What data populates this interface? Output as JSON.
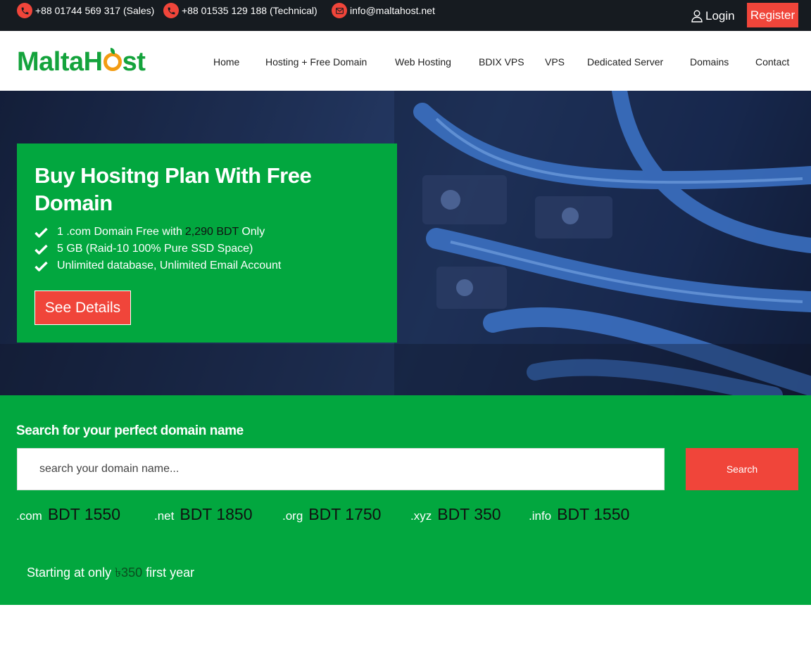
{
  "topbar": {
    "sales_phone": "+88 01744 569 317 (Sales)",
    "tech_phone": "+88 01535 129 188 (Technical)",
    "email": "info@maltahost.net",
    "login": "Login",
    "register": "Register"
  },
  "header": {
    "logo_part1": "Malta",
    "logo_part2": "H",
    "logo_part3": "st",
    "nav": [
      "Home",
      "Hosting + Free Domain",
      "Web Hosting",
      "BDIX VPS",
      "VPS",
      "Dedicated Server",
      "Domains",
      "Contact"
    ]
  },
  "hero": {
    "title": "Buy Hositng Plan With Free Domain",
    "features": [
      {
        "pre": "1 .com Domain Free with",
        "highlight": "2,290 BDT",
        "post": "Only"
      },
      {
        "text": "5 GB (Raid-10 100% Pure SSD Space)"
      },
      {
        "text": "Unlimited database, Unlimited Email Account"
      }
    ],
    "cta": "See Details"
  },
  "domain_search": {
    "title": "Search for your perfect domain name",
    "placeholder": "search your domain name...",
    "button": "Search",
    "tlds": [
      {
        "ext": ".com",
        "price": "BDT 1550"
      },
      {
        "ext": ".net",
        "price": "BDT 1850"
      },
      {
        "ext": ".org",
        "price": "BDT 1750"
      },
      {
        "ext": ".xyz",
        "price": "BDT 350"
      },
      {
        "ext": ".info",
        "price": "BDT 1550"
      }
    ],
    "starting_pre": "Starting at only",
    "starting_amount": "৳350",
    "starting_post": "first year"
  },
  "colors": {
    "accent_red": "#f0453a",
    "brand_green": "#02a73f",
    "topbar_bg": "#161b20",
    "logo_orange": "#f39c12"
  },
  "icons": [
    "phone-icon",
    "mail-icon",
    "user-icon",
    "check-icon"
  ]
}
